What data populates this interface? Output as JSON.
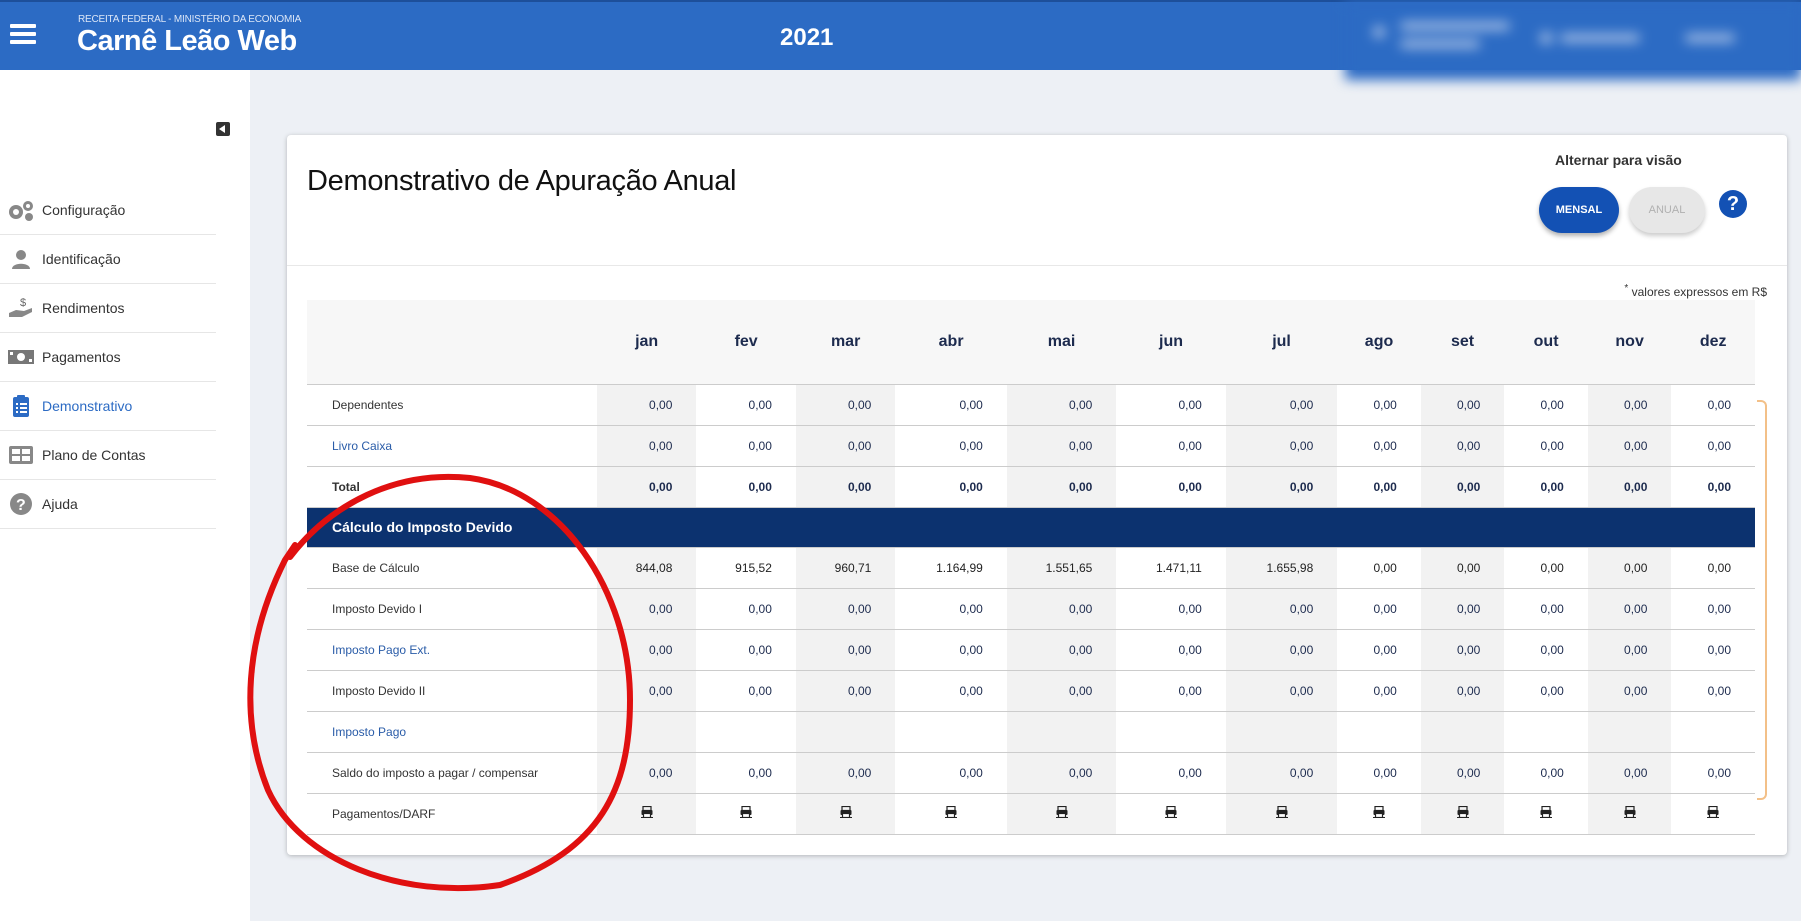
{
  "header": {
    "agency": "RECEITA FEDERAL - MINISTÉRIO DA ECONOMIA",
    "app_title": "Carnê Leão Web",
    "year": "2021"
  },
  "sidebar": {
    "items": [
      {
        "label": "Configuração",
        "icon": "gears-icon"
      },
      {
        "label": "Identificação",
        "icon": "user-icon"
      },
      {
        "label": "Rendimentos",
        "icon": "hand-money-icon"
      },
      {
        "label": "Pagamentos",
        "icon": "banknote-icon"
      },
      {
        "label": "Demonstrativo",
        "icon": "clipboard-list-icon",
        "active": true
      },
      {
        "label": "Plano de Contas",
        "icon": "table-icon"
      },
      {
        "label": "Ajuda",
        "icon": "question-icon"
      }
    ]
  },
  "main": {
    "title": "Demonstrativo de Apuração Anual",
    "toggle_label": "Alternar para visão",
    "btn_mensal": "MENSAL",
    "btn_anual": "ANUAL",
    "help": "?",
    "note_star": "*",
    "note": "valores expressos em R$",
    "months": [
      "jan",
      "fev",
      "mar",
      "abr",
      "mai",
      "jun",
      "jul",
      "ago",
      "set",
      "out",
      "nov",
      "dez"
    ],
    "rows_top": [
      {
        "label": "Dependentes",
        "values": [
          "0,00",
          "0,00",
          "0,00",
          "0,00",
          "0,00",
          "0,00",
          "0,00",
          "0,00",
          "0,00",
          "0,00",
          "0,00",
          "0,00"
        ]
      },
      {
        "label": "Livro Caixa",
        "link": true,
        "values": [
          "0,00",
          "0,00",
          "0,00",
          "0,00",
          "0,00",
          "0,00",
          "0,00",
          "0,00",
          "0,00",
          "0,00",
          "0,00",
          "0,00"
        ]
      },
      {
        "label": "Total",
        "total": true,
        "values": [
          "0,00",
          "0,00",
          "0,00",
          "0,00",
          "0,00",
          "0,00",
          "0,00",
          "0,00",
          "0,00",
          "0,00",
          "0,00",
          "0,00"
        ]
      }
    ],
    "section_label": "Cálculo do Imposto Devido",
    "rows_bottom": [
      {
        "label": "Base de Cálculo",
        "black": true,
        "values": [
          "844,08",
          "915,52",
          "960,71",
          "1.164,99",
          "1.551,65",
          "1.471,11",
          "1.655,98",
          "0,00",
          "0,00",
          "0,00",
          "0,00",
          "0,00"
        ]
      },
      {
        "label": "Imposto Devido I",
        "values": [
          "0,00",
          "0,00",
          "0,00",
          "0,00",
          "0,00",
          "0,00",
          "0,00",
          "0,00",
          "0,00",
          "0,00",
          "0,00",
          "0,00"
        ]
      },
      {
        "label": "Imposto Pago Ext.",
        "link": true,
        "values": [
          "0,00",
          "0,00",
          "0,00",
          "0,00",
          "0,00",
          "0,00",
          "0,00",
          "0,00",
          "0,00",
          "0,00",
          "0,00",
          "0,00"
        ]
      },
      {
        "label": "Imposto Devido II",
        "values": [
          "0,00",
          "0,00",
          "0,00",
          "0,00",
          "0,00",
          "0,00",
          "0,00",
          "0,00",
          "0,00",
          "0,00",
          "0,00",
          "0,00"
        ]
      },
      {
        "label": "Imposto Pago",
        "link": true,
        "values": [
          "",
          "",
          "",
          "",
          "",
          "",
          "",
          "",
          "",
          "",
          "",
          ""
        ]
      },
      {
        "label": "Saldo do imposto a pagar / compensar",
        "values": [
          "0,00",
          "0,00",
          "0,00",
          "0,00",
          "0,00",
          "0,00",
          "0,00",
          "0,00",
          "0,00",
          "0,00",
          "0,00",
          "0,00"
        ]
      },
      {
        "label": "Pagamentos/DARF",
        "printers": true,
        "values": []
      }
    ]
  },
  "colors": {
    "header_blue": "#2c6bc4",
    "section_navy": "#0c326f",
    "button_blue": "#1351b4",
    "annotation_red": "#e01010"
  }
}
